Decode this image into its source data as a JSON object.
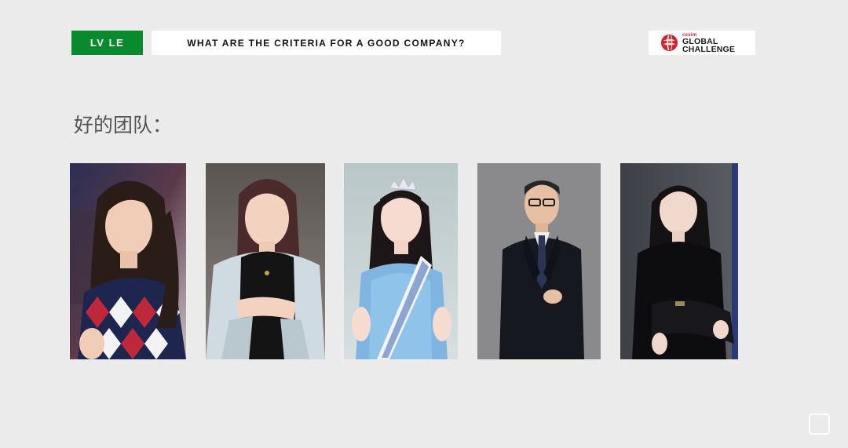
{
  "header": {
    "team_label": "LV LE",
    "question": "WHAT ARE THE CRITERIA FOR A GOOD COMPANY?",
    "logo": {
      "small_text": "cesim",
      "line1": "GLOBAL",
      "line2": "CHALLENGE",
      "icon": "cesim-globe-icon",
      "accent_color": "#d71f2b"
    },
    "badge_color": "#0a8a2e"
  },
  "main": {
    "heading": "好的团队："
  },
  "photos": [
    {
      "name": "team-member-photo-1",
      "description_icon": "portrait-woman-argyle-sweater"
    },
    {
      "name": "team-member-photo-2",
      "description_icon": "portrait-woman-light-blazer"
    },
    {
      "name": "team-member-photo-3",
      "description_icon": "portrait-woman-tiara-sash"
    },
    {
      "name": "team-member-photo-4",
      "description_icon": "portrait-man-suit"
    },
    {
      "name": "team-member-photo-5",
      "description_icon": "portrait-woman-black-suit"
    }
  ],
  "controls": {
    "corner_icon": "square-outline-icon"
  }
}
